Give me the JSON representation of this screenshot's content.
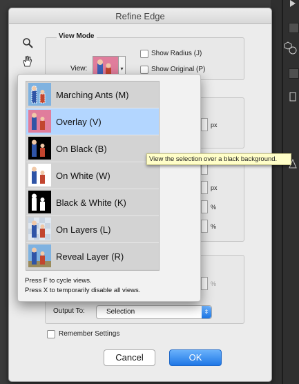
{
  "dialog": {
    "title": "Refine Edge"
  },
  "tools": {
    "zoom_icon": "magnifier-icon",
    "hand_icon": "hand-icon"
  },
  "view_mode": {
    "group_label": "View Mode",
    "view_label": "View:",
    "show_radius_label": "Show Radius (J)",
    "show_original_label": "Show Original (P)"
  },
  "units": {
    "px": "px",
    "percent": "%"
  },
  "popup": {
    "items": [
      {
        "label": "Marching Ants (M)",
        "thumb": "marching-ants"
      },
      {
        "label": "Overlay (V)",
        "thumb": "overlay",
        "selected": true
      },
      {
        "label": "On Black (B)",
        "thumb": "on-black"
      },
      {
        "label": "On White (W)",
        "thumb": "on-white"
      },
      {
        "label": "Black & White (K)",
        "thumb": "black-white"
      },
      {
        "label": "On Layers (L)",
        "thumb": "on-layers"
      },
      {
        "label": "Reveal Layer (R)",
        "thumb": "reveal-layer"
      }
    ],
    "hint_cycle": "Press F to cycle views.",
    "hint_disable": "Press X to temporarily disable all views."
  },
  "tooltip": {
    "text": "View the selection over a black background."
  },
  "output": {
    "label": "Output To:",
    "value": "Selection"
  },
  "remember_settings": {
    "label": "Remember Settings",
    "checked": false
  },
  "buttons": {
    "cancel": "Cancel",
    "ok": "OK"
  },
  "colors": {
    "selection": "#b3d6ff",
    "ok_button": "#1f77e6",
    "tooltip_bg": "#fffec8"
  }
}
